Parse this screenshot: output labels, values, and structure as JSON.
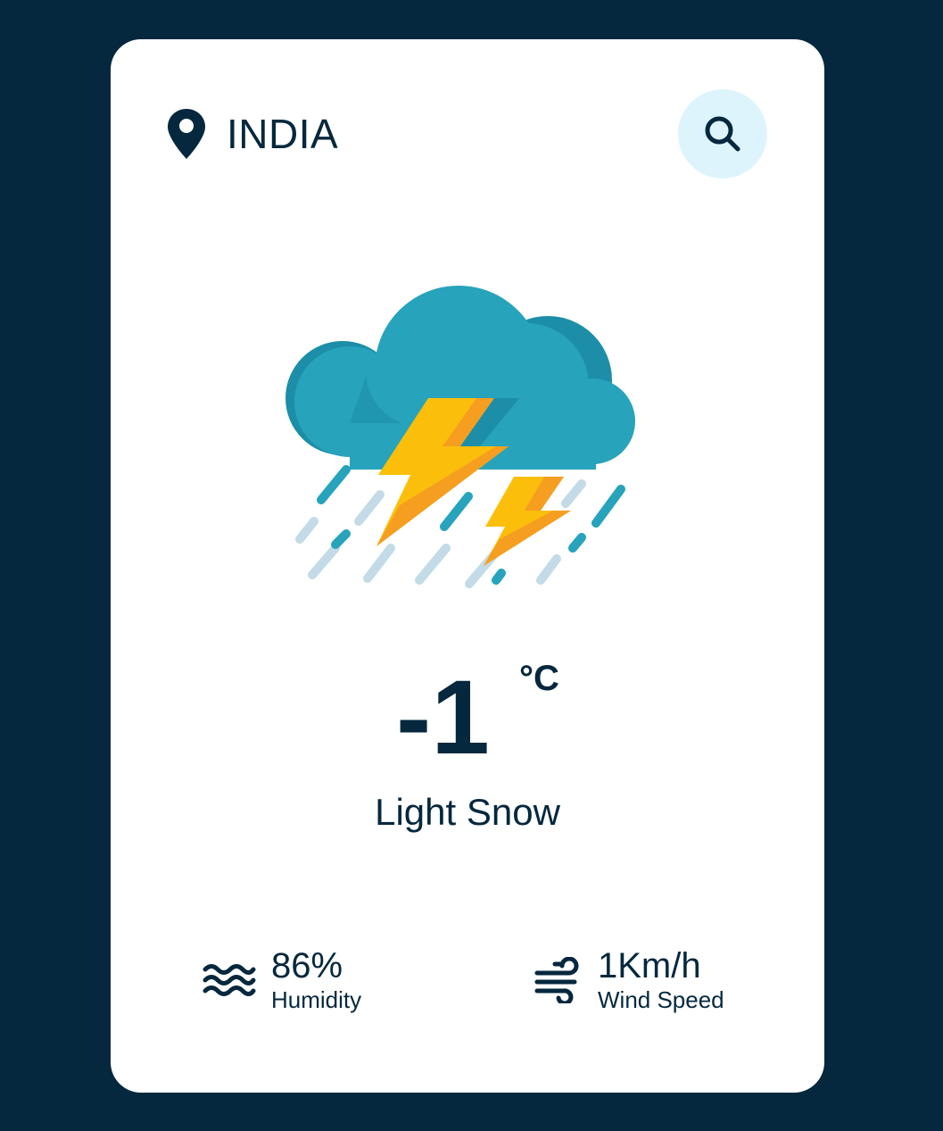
{
  "location": {
    "city": "INDIA",
    "icon": "map-pin-icon"
  },
  "search": {
    "icon": "search-icon"
  },
  "weather": {
    "icon": "thunderstorm-rain-icon",
    "temperature": "-1",
    "unit": "°C",
    "description": "Light Snow"
  },
  "humidity": {
    "icon": "waves-icon",
    "value": "86%",
    "label": "Humidity"
  },
  "wind": {
    "icon": "wind-icon",
    "value": "1Km/h",
    "label": "Wind Speed"
  },
  "colors": {
    "background": "#05283e",
    "card": "#ffffff",
    "accent": "#def4fd",
    "cloud": "#27a3bb",
    "lightning": "#fbbf0b"
  }
}
